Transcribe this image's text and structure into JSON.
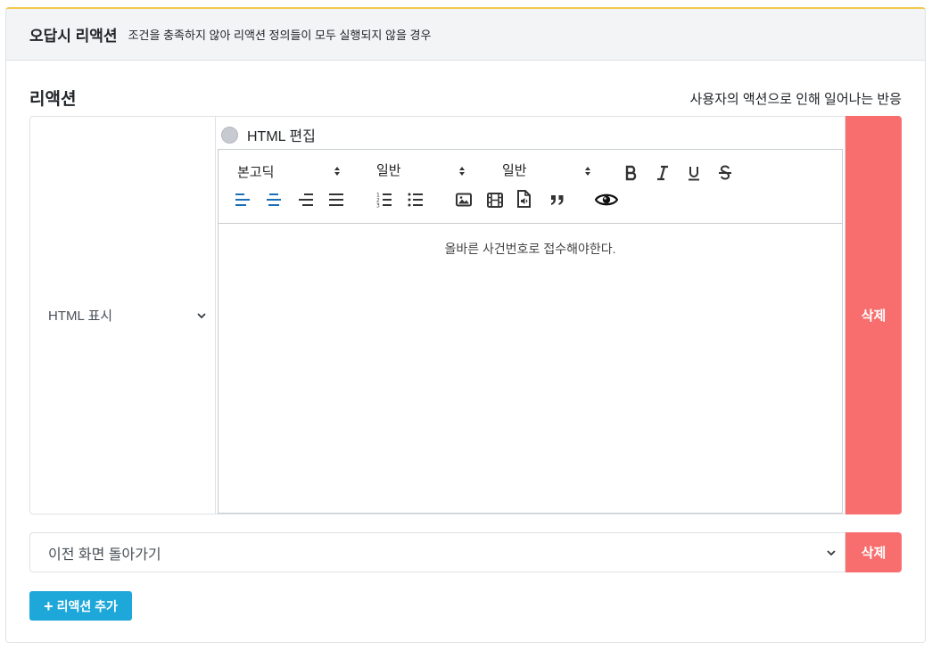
{
  "header": {
    "title": "오답시 리액션",
    "subtitle": "조건을 충족하지 않아 리액션 정의들이 모두 실행되지 않을 경우"
  },
  "section": {
    "title": "리액션",
    "description": "사용자의 액션으로 인해 일어나는 반응"
  },
  "reaction1": {
    "type_selected": "HTML 표시",
    "html_edit_label": "HTML 편집",
    "html_edit_checked": false,
    "toolbar": {
      "font_family": "본고딕",
      "font_size": "일반",
      "heading": "일반"
    },
    "content": "올바른 사건번호로 접수해야한다.",
    "delete_label": "삭제"
  },
  "reaction2": {
    "type_selected": "이전 화면 돌아가기",
    "delete_label": "삭제"
  },
  "add_button": {
    "icon": "plus-icon",
    "label": "리액션 추가"
  },
  "colors": {
    "accent_top": "#f2c94c",
    "delete": "#f86d6d",
    "primary": "#1ea7d9",
    "align_active": "#1a6fb8"
  }
}
